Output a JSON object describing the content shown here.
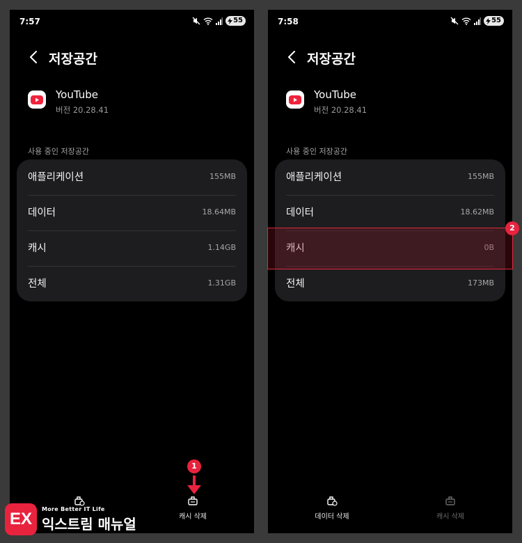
{
  "left": {
    "status_time": "7:57",
    "battery": "55",
    "title": "저장공간",
    "app_name": "YouTube",
    "app_version": "버전 20.28.41",
    "section_label": "사용 중인 저장공간",
    "rows": [
      {
        "label": "애플리케이션",
        "value": "155MB"
      },
      {
        "label": "데이터",
        "value": "18.64MB"
      },
      {
        "label": "캐시",
        "value": "1.14GB"
      },
      {
        "label": "전체",
        "value": "1.31GB"
      }
    ],
    "action_label": "캐시 삭제"
  },
  "right": {
    "status_time": "7:58",
    "battery": "55",
    "title": "저장공간",
    "app_name": "YouTube",
    "app_version": "버전 20.28.41",
    "section_label": "사용 중인 저장공간",
    "rows": [
      {
        "label": "애플리케이션",
        "value": "155MB"
      },
      {
        "label": "데이터",
        "value": "18.62MB"
      },
      {
        "label": "캐시",
        "value": "0B"
      },
      {
        "label": "전체",
        "value": "173MB"
      }
    ],
    "actions": [
      {
        "label": "데이터 삭제",
        "enabled": true
      },
      {
        "label": "캐시 삭제",
        "enabled": false
      }
    ]
  },
  "annotations": {
    "step1": "1",
    "step2": "2",
    "highlight_color": "#e8233e"
  },
  "logo": {
    "mark": "EX",
    "tagline": "More Better IT Life",
    "name": "익스트림 매뉴얼"
  },
  "colors": {
    "background": "#000000",
    "card": "#1d1d1f",
    "accent": "#e8233e"
  }
}
